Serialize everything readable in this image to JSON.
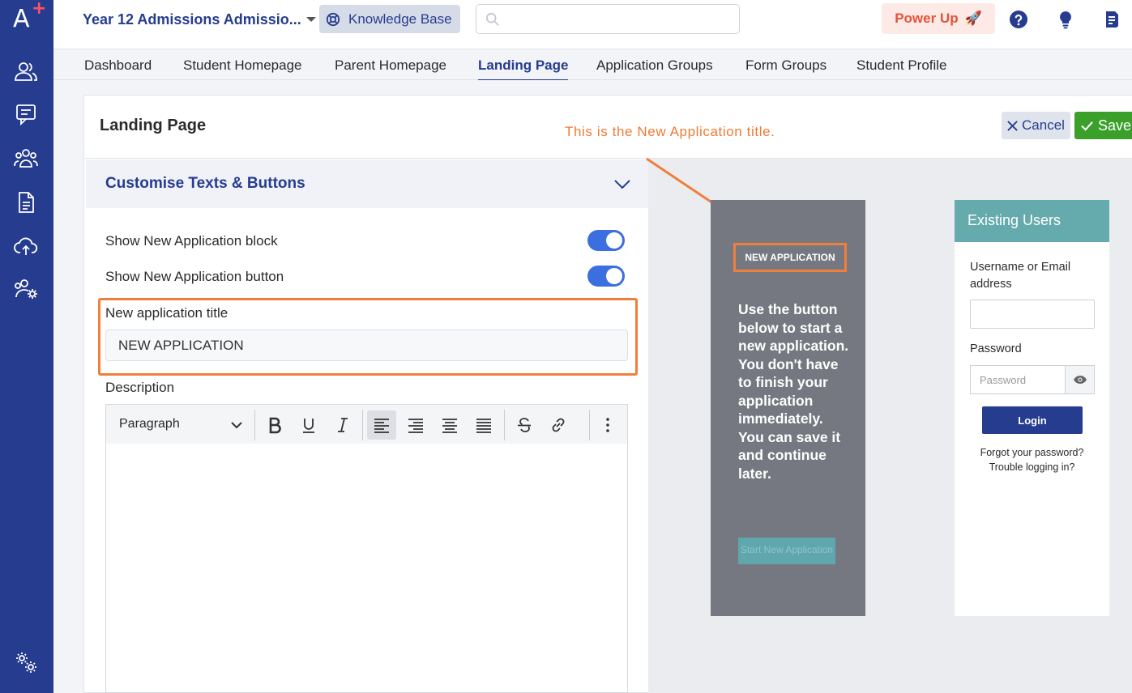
{
  "sidebar": {
    "logo_letter": "A",
    "logo_plus": "+",
    "icons": [
      "users-icon",
      "chat-icon",
      "group-icon",
      "document-icon",
      "cloud-upload-icon",
      "user-settings-icon",
      "settings-icon"
    ]
  },
  "header": {
    "app_name": "Year 12 Admissions Admissio...",
    "knowledge_base_label": "Knowledge Base",
    "search_placeholder": "",
    "power_up_label": "Power Up",
    "power_up_icon": "🚀"
  },
  "nav": {
    "tabs": [
      {
        "label": "Dashboard",
        "active": false
      },
      {
        "label": "Student Homepage",
        "active": false
      },
      {
        "label": "Parent Homepage",
        "active": false
      },
      {
        "label": "Landing Page",
        "active": true
      },
      {
        "label": "Application Groups",
        "active": false
      },
      {
        "label": "Form Groups",
        "active": false
      },
      {
        "label": "Student Profile",
        "active": false
      }
    ]
  },
  "page": {
    "title": "Landing Page",
    "cancel_label": "Cancel",
    "save_label": "Save"
  },
  "panel": {
    "section_title": "Customise Texts & Buttons",
    "toggle_block_label": "Show New Application block",
    "toggle_block_on": true,
    "toggle_button_label": "Show New Application button",
    "toggle_button_on": true,
    "title_field_label": "New application title",
    "title_field_value": "NEW APPLICATION",
    "description_label": "Description",
    "editor": {
      "format_value": "Paragraph"
    }
  },
  "annotation": {
    "text": "This is the New Application title."
  },
  "preview": {
    "new_app_title": "NEW APPLICATION",
    "new_app_description": "Use the button below to start a new application. You don't have to finish your application immediately. You can save it and continue later.",
    "start_button_label": "Start New Application",
    "existing_title": "Existing Users",
    "username_label": "Username or Email address",
    "password_label": "Password",
    "password_placeholder": "Password",
    "login_label": "Login",
    "forgot_label": "Forgot your password?",
    "trouble_label": "Trouble logging in?"
  },
  "colors": {
    "sidebar": "#263c8f",
    "accent": "#263c8f",
    "highlight": "#f07f3c",
    "save": "#3aa02a",
    "toggle": "#3b6fe0",
    "preview_panel": "#757880",
    "existing_header": "#65abad"
  }
}
